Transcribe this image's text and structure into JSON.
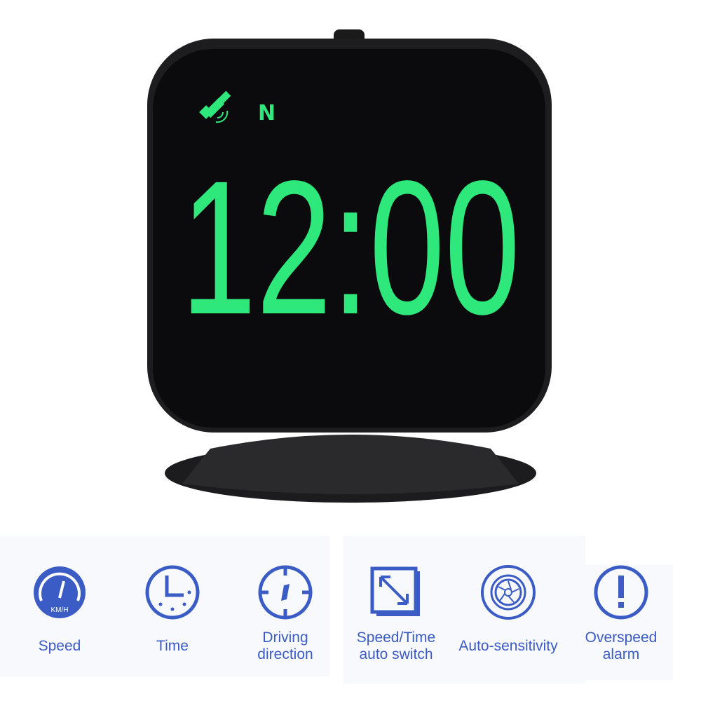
{
  "display": {
    "time": "12:00",
    "direction": "N",
    "gps_icon": "satellite-icon",
    "digit_color": "#2ee87c",
    "body_color": "#0b0b0d"
  },
  "features": [
    {
      "label": "Speed",
      "icon": "speedometer-icon",
      "unit": "KM/H"
    },
    {
      "label": "Time",
      "icon": "clock-icon"
    },
    {
      "label": "Driving direction",
      "icon": "compass-icon"
    },
    {
      "label": "Speed/Time auto switch",
      "icon": "switch-arrow-icon"
    },
    {
      "label": "Auto-sensitivity",
      "icon": "sensor-icon"
    },
    {
      "label": "Overspeed alarm",
      "icon": "alert-icon"
    }
  ],
  "accent_color": "#3b5cc4"
}
